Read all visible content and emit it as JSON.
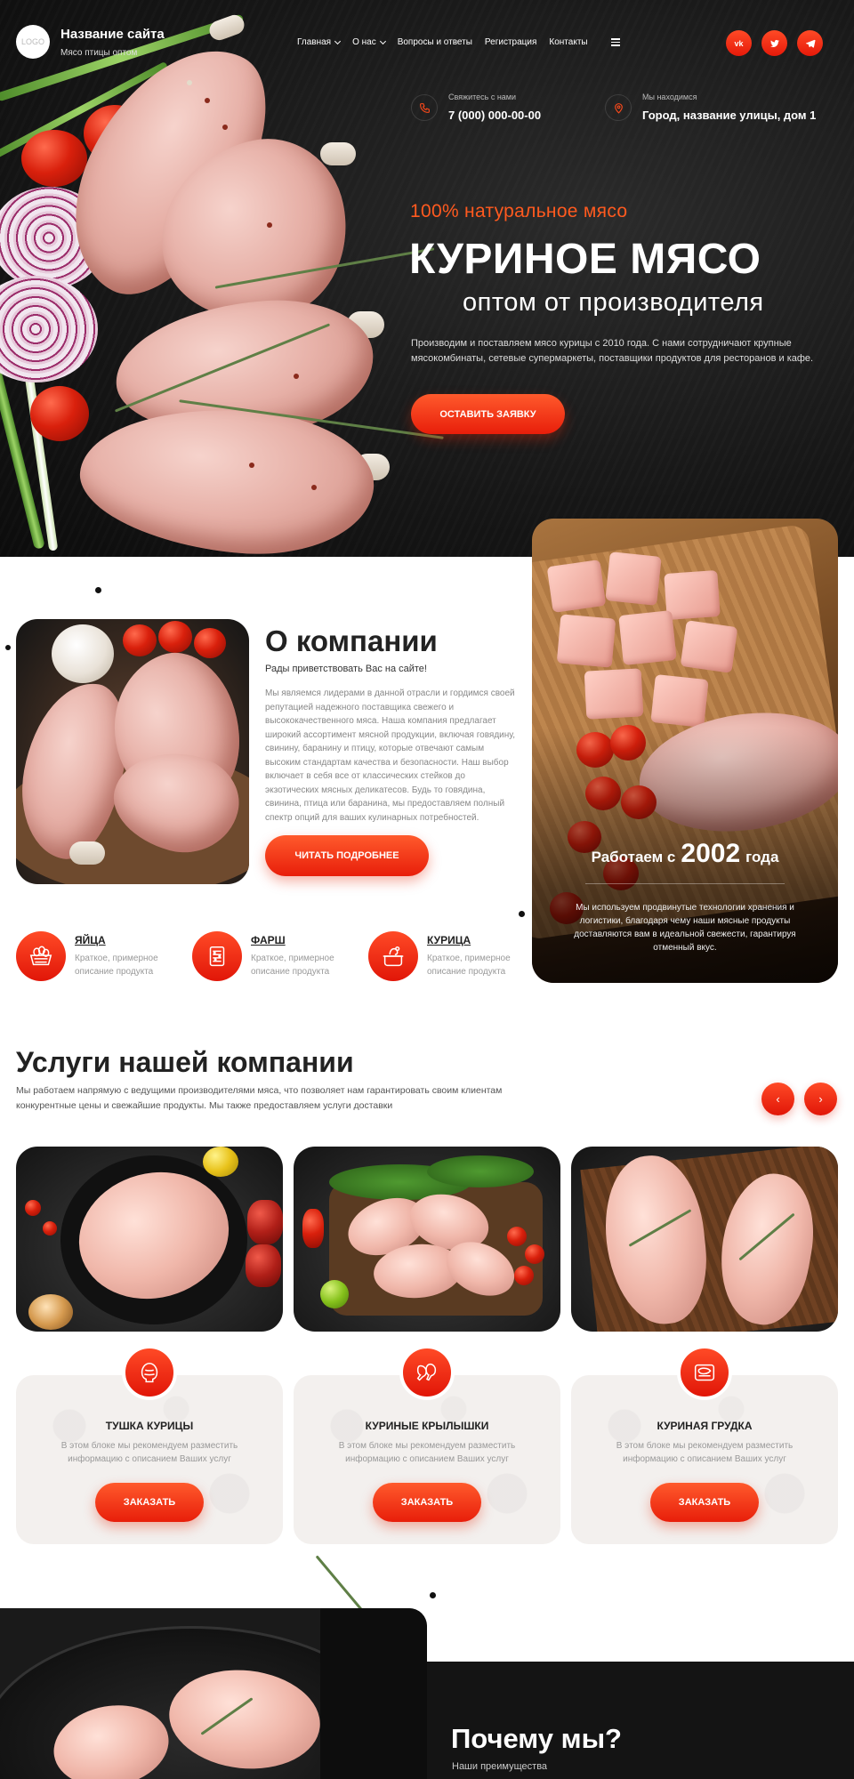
{
  "header": {
    "logo_text": "LOGO",
    "site_name": "Название сайта",
    "site_subtitle": "Мясо птицы оптом",
    "nav": [
      {
        "label": "Главная",
        "dropdown": true
      },
      {
        "label": "О нас",
        "dropdown": true
      },
      {
        "label": "Вопросы и ответы",
        "dropdown": false
      },
      {
        "label": "Регистрация",
        "dropdown": false
      },
      {
        "label": "Контакты",
        "dropdown": false
      }
    ],
    "socials": [
      "vk",
      "tw",
      "tg"
    ]
  },
  "contacts": {
    "phone_label": "Свяжитесь с нами",
    "phone": "7 (000) 000-00-00",
    "address_label": "Мы находимся",
    "address": "Город, название улицы, дом 1"
  },
  "hero": {
    "eyebrow": "100% натуральное мясо",
    "title": "КУРИНОЕ МЯСО",
    "subtitle": "оптом от производителя",
    "description": "Производим и поставляем мясо курицы с 2010 года. С нами сотрудничают крупные мясокомбинаты, сетевые супермаркеты, поставщики продуктов для ресторанов и кафе.",
    "button": "ОСТАВИТЬ ЗАЯВКУ"
  },
  "about": {
    "title": "О компании",
    "subtitle": "Рады приветствовать Вас на сайте!",
    "text": "Мы являемся лидерами в данной отрасли и гордимся своей репутацией надежного поставщика свежего и высококачественного мяса. Наша компания предлагает широкий ассортимент мясной продукции, включая говядину, свинину, баранину и птицу, которые отвечают самым высоким стандартам качества и безопасности. Наш выбор включает в себя все от классических стейков до экзотических мясных деликатесов. Будь то говядина, свинина, птица или баранина, мы предоставляем полный спектр опций для ваших кулинарных потребностей.",
    "button": "ЧИТАТЬ ПОДРОБНЕЕ",
    "since_prefix": "Работаем с",
    "since_year": "2002",
    "since_suffix": "года",
    "since_text": "Мы используем продвинутые технологии хранения и логистики, благодаря чему наши мясные продукты доставляются вам в идеальной свежести, гарантируя отменный вкус.",
    "features": [
      {
        "title": "ЯЙЦА",
        "desc": "Краткое, примерное описание продукта",
        "icon": "eggs-basket-icon"
      },
      {
        "title": "ФАРШ",
        "desc": "Краткое, примерное описание продукта",
        "icon": "mince-grinder-icon"
      },
      {
        "title": "КУРИЦА",
        "desc": "Краткое, примерное описание продукта",
        "icon": "chicken-pot-icon"
      }
    ]
  },
  "services": {
    "title": "Услуги нашей компании",
    "description": "Мы работаем напрямую с ведущими производителями мяса, что позволяет нам гарантировать своим клиентам конкурентные цены и свежайшие продукты. Мы также предоставляем услуги доставки",
    "prev": "‹",
    "next": "›",
    "items": [
      {
        "name": "ТУШКА КУРИЦЫ",
        "text": "В этом блоке мы рекомендуем разместить информацию с описанием Ваших услуг",
        "button": "ЗАКАЗАТЬ",
        "icon": "whole-chicken-icon"
      },
      {
        "name": "КУРИНЫЕ КРЫЛЫШКИ",
        "text": "В этом блоке мы рекомендуем разместить информацию с описанием Ваших услуг",
        "button": "ЗАКАЗАТЬ",
        "icon": "chicken-wings-icon"
      },
      {
        "name": "КУРИНАЯ ГРУДКА",
        "text": "В этом блоке мы рекомендуем разместить информацию с описанием Ваших услуг",
        "button": "ЗАКАЗАТЬ",
        "icon": "chicken-breast-icon"
      }
    ]
  },
  "why": {
    "title": "Почему мы?",
    "subtitle": "Наши преимущества"
  },
  "colors": {
    "accent": "#ff4a26",
    "accent_dark": "#e11608",
    "hero_bg": "#161616"
  }
}
